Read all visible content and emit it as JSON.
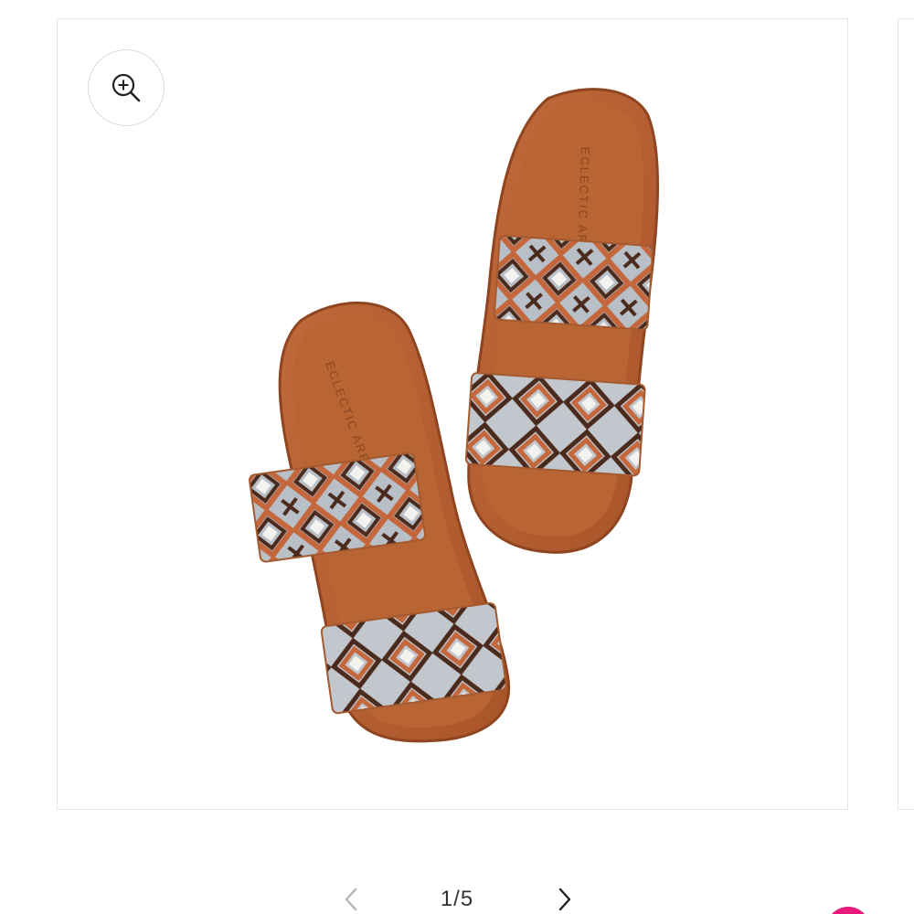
{
  "gallery": {
    "product_image_alt": "Woven two-strap slide sandals",
    "brand_stamp": "ECLECTIC ARRAY",
    "pager": {
      "current": "1",
      "separator": "/",
      "total": "5",
      "label": "1/5"
    },
    "icons": {
      "zoom": "zoom-in-icon",
      "prev": "chevron-left-icon",
      "next": "chevron-right-icon"
    }
  },
  "colors": {
    "leather": "#b8622f",
    "leather_dark": "#8f4520",
    "weave_grey": "#b9bfc6",
    "weave_rust": "#c4673c",
    "weave_brown": "#4a2a1c",
    "weave_white": "#f4f2ef",
    "accent": "#e8197a"
  }
}
